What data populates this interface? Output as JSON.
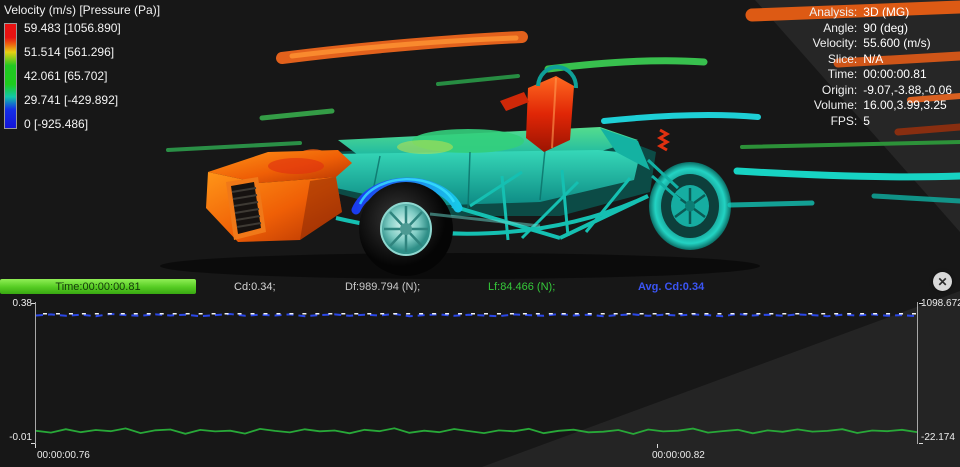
{
  "legend": {
    "title": "Velocity (m/s) [Pressure (Pa)]",
    "entries": [
      "59.483 [1056.890]",
      "51.514 [561.296]",
      "42.061 [65.702]",
      "29.741 [-429.892]",
      "0 [-925.486]"
    ]
  },
  "info": {
    "rows": [
      {
        "label": "Analysis:",
        "value": "3D (MG)"
      },
      {
        "label": "Angle:",
        "value": "90 (deg)"
      },
      {
        "label": "Velocity:",
        "value": "55.600 (m/s)"
      },
      {
        "label": "Slice:",
        "value": "N/A"
      },
      {
        "label": "Time:",
        "value": "00:00:00.81"
      },
      {
        "label": "Origin:",
        "value": "-9.07,-3.88,-0.06"
      },
      {
        "label": "Volume:",
        "value": "16.00,3.99,3.25"
      },
      {
        "label": "FPS:",
        "value": "5"
      }
    ]
  },
  "status": {
    "time": "Time:00:00:00.81",
    "cd": "Cd:0.34;",
    "df": "Df:989.794 (N);",
    "lf": "Lf:84.466 (N);",
    "avg_cd": "Avg. Cd:0.34",
    "close": "✕"
  },
  "chart_data": {
    "type": "line",
    "x_tick_labels": [
      "00:00:00.76",
      "00:00:00.82"
    ],
    "left_axis": {
      "min": -0.01,
      "max": 0.38,
      "top_label": "0.38",
      "bottom_label": "-0.01"
    },
    "right_axis": {
      "min": -22.174,
      "max": 1098.672,
      "top_label": "1098.672",
      "bottom_label": "-22.174"
    },
    "legend_position": "none",
    "grid": false,
    "series": [
      {
        "name": "Cd",
        "axis": "left",
        "color": "#2b48e8",
        "width": 2,
        "dash": "7 5",
        "dashoffset": 0,
        "values": [
          0.343,
          0.346,
          0.342,
          0.345,
          0.341,
          0.347,
          0.344,
          0.342,
          0.346,
          0.343,
          0.345,
          0.341,
          0.344,
          0.347,
          0.342,
          0.345,
          0.343,
          0.346,
          0.341,
          0.344,
          0.346,
          0.342,
          0.345,
          0.343,
          0.347,
          0.341,
          0.344,
          0.346,
          0.342,
          0.345,
          0.343,
          0.341,
          0.346,
          0.344,
          0.342,
          0.347,
          0.343,
          0.345,
          0.341,
          0.344,
          0.346,
          0.342,
          0.345,
          0.343,
          0.346,
          0.344,
          0.341,
          0.347,
          0.343,
          0.345,
          0.342,
          0.346,
          0.344,
          0.341,
          0.345,
          0.343,
          0.346,
          0.342,
          0.344,
          0.341
        ]
      },
      {
        "name": "Avg Cd",
        "axis": "left",
        "color": "#f2f2f2",
        "width": 1.5,
        "dash": "4 9",
        "dashoffset": 6,
        "values": [
          0.348,
          0.348
        ]
      },
      {
        "name": "Lf",
        "axis": "right",
        "color": "#28a838",
        "width": 1.8,
        "dash": "",
        "dashoffset": 0,
        "values": [
          82,
          68,
          95,
          71,
          88,
          79,
          101,
          64,
          86,
          92,
          58,
          89,
          77,
          83,
          60,
          97,
          81,
          69,
          94,
          78,
          84,
          62,
          90,
          79,
          102,
          66,
          83,
          71,
          96,
          80,
          64,
          85,
          78,
          98,
          63,
          82,
          91,
          70,
          75,
          88,
          57,
          92,
          77,
          83,
          99,
          68,
          80,
          90,
          62,
          85,
          74,
          93,
          76,
          81,
          95,
          65,
          84,
          79,
          90,
          72
        ]
      }
    ]
  }
}
